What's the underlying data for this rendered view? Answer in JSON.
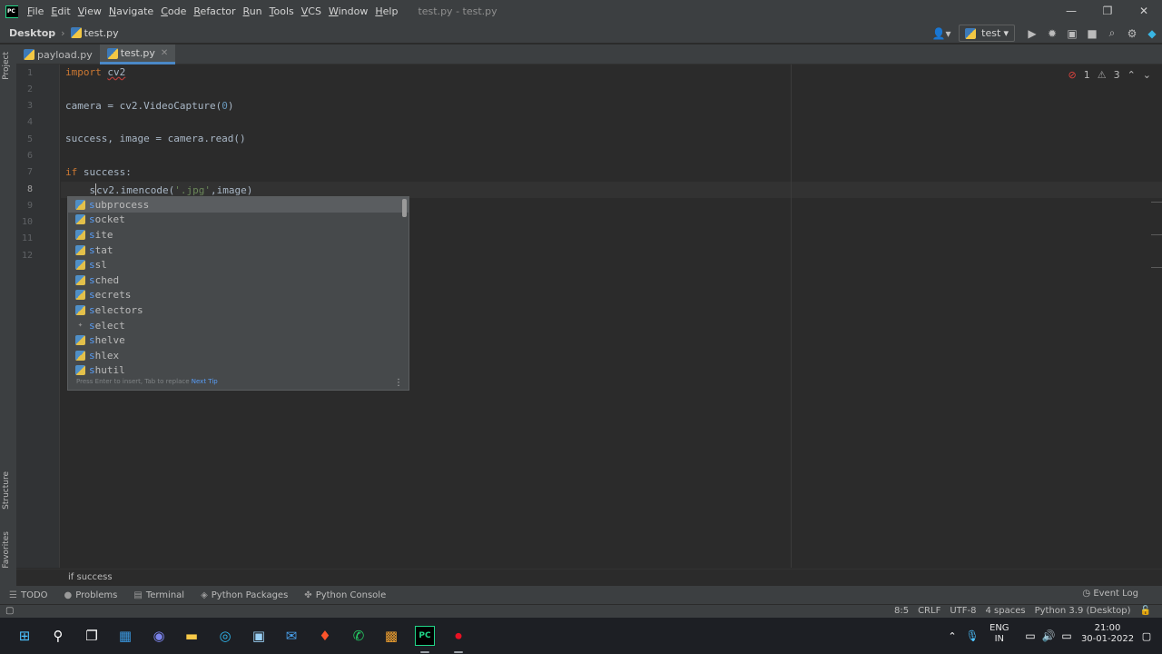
{
  "window": {
    "menu": [
      "File",
      "Edit",
      "View",
      "Navigate",
      "Code",
      "Refactor",
      "Run",
      "Tools",
      "VCS",
      "Window",
      "Help"
    ],
    "title": "test.py - test.py",
    "controls": [
      "—",
      "❐",
      "✕"
    ]
  },
  "navbar": {
    "root": "Desktop",
    "file": "test.py",
    "run_config": "test"
  },
  "tool_strip": {
    "project": "Project",
    "structure": "Structure",
    "favorites": "Favorites"
  },
  "tabs": [
    {
      "label": "payload.py",
      "active": false
    },
    {
      "label": "test.py",
      "active": true
    }
  ],
  "editor": {
    "line_numbers": [
      "1",
      "2",
      "3",
      "4",
      "5",
      "6",
      "7",
      "8",
      "9",
      "10",
      "11",
      "12"
    ],
    "inspections": {
      "errors": "1",
      "warnings": "3"
    }
  },
  "completion": {
    "typed_prefix": "s",
    "items": [
      "subprocess",
      "socket",
      "site",
      "stat",
      "ssl",
      "sched",
      "secrets",
      "selectors",
      "select",
      "shelve",
      "shlex",
      "shutil"
    ],
    "hint": "Press Enter to insert, Tab to replace",
    "next_tip": "Next Tip"
  },
  "breadcrumb_bar": "if success",
  "tool_windows": [
    "TODO",
    "Problems",
    "Terminal",
    "Python Packages",
    "Python Console"
  ],
  "event_log": "Event Log",
  "status": {
    "position": "8:5",
    "line_sep": "CRLF",
    "encoding": "UTF-8",
    "indent": "4 spaces",
    "interpreter": "Python 3.9 (Desktop)"
  },
  "taskbar": {
    "lang": "ENG",
    "region": "IN",
    "time": "21:00",
    "date": "30-01-2022"
  }
}
